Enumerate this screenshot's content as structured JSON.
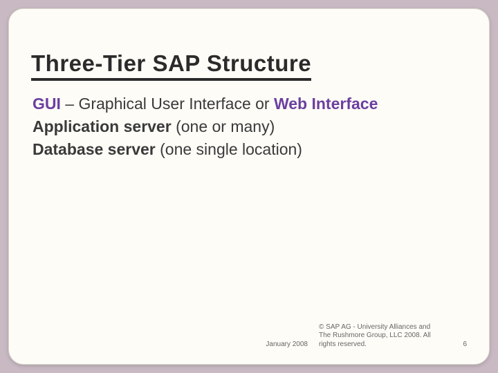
{
  "title": "Three-Tier SAP Structure",
  "bullets": {
    "b0": {
      "icon": "",
      "strong": "GUI",
      "mid": " – Graphical User Interface or ",
      "strong2": "Web Interface"
    },
    "b1": {
      "icon": "",
      "strong": "Application server",
      "rest": " (one or many)"
    },
    "b2": {
      "icon": "",
      "strong": "Database server",
      "rest": " (one single location)"
    }
  },
  "footer": {
    "date": "January 2008",
    "copyright": "© SAP AG - University Alliances and The Rushmore Group, LLC 2008. All rights reserved.",
    "page": "6"
  }
}
